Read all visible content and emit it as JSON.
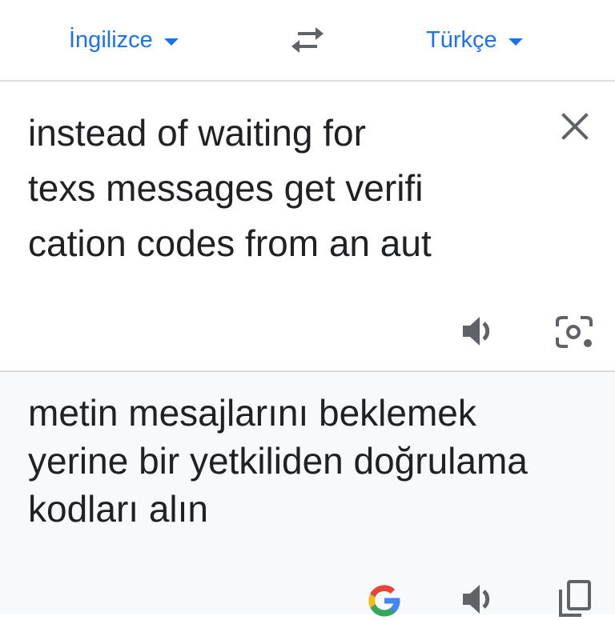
{
  "languages": {
    "source": "İngilizce",
    "target": "Türkçe"
  },
  "source": {
    "text": "instead of waiting for\ntexs messages get verifi\ncation codes from an aut"
  },
  "result": {
    "text": "metin mesajlarını beklemek\nyerine bir yetkiliden doğrulama\nkodları alın"
  },
  "icons": {
    "lang_dropdown": "caret-down-icon",
    "swap": "swap-languages-icon",
    "clear": "close-icon",
    "speaker": "volume-icon",
    "camera": "camera-icon",
    "google": "google-logo-icon",
    "copy": "copy-icon"
  },
  "colors": {
    "accent": "#1a73e8",
    "text": "#202124",
    "icon": "#5f6368",
    "result_bg": "#f8f9fa",
    "divider": "#dadce0"
  }
}
